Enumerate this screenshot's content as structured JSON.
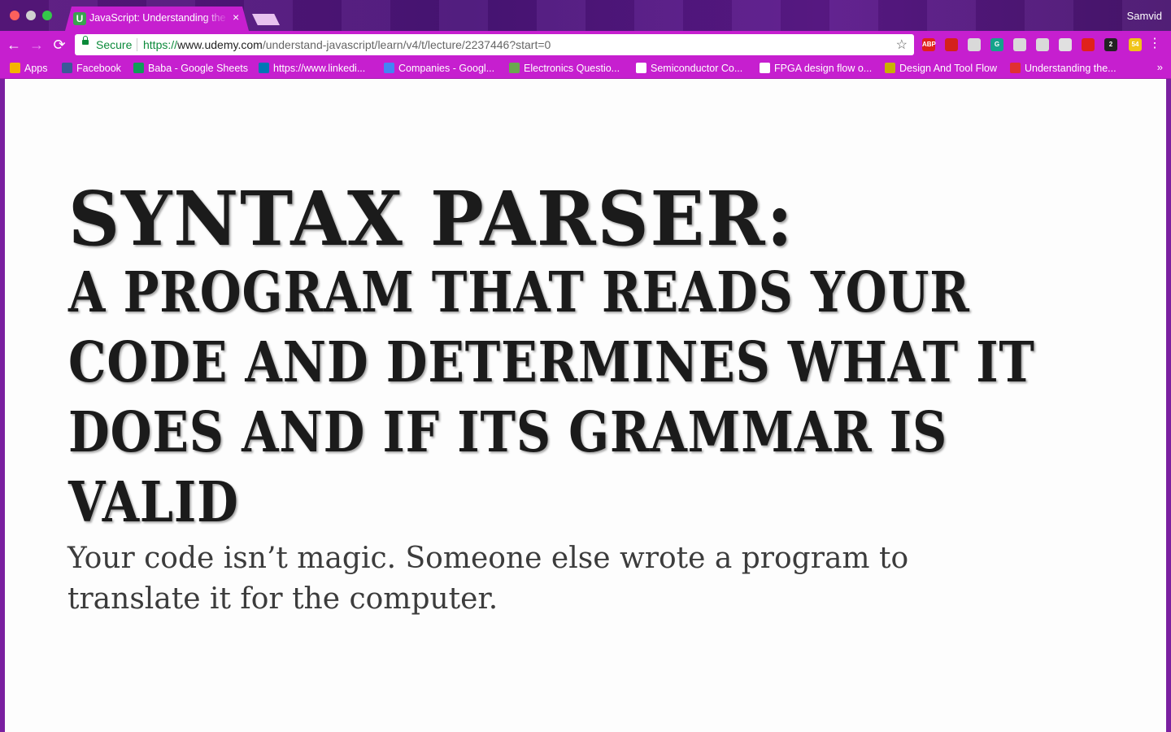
{
  "browser": {
    "tab": {
      "title": "JavaScript: Understanding the Weird Parts",
      "favicon_letter": "U",
      "close_label": "×"
    },
    "profile_name": "Samvid",
    "nav": {
      "back": "←",
      "forward": "→",
      "reload": "⟳"
    },
    "omnibox": {
      "secure_label": "Secure",
      "url_proto": "https://",
      "url_host": "www.udemy.com",
      "url_path": "/understand-javascript/learn/v4/t/lecture/2237446?start=0",
      "star": "☆"
    },
    "extensions": [
      {
        "name": "adblock-plus-icon",
        "label": "ABP",
        "color": "#e0221b"
      },
      {
        "name": "ublock-icon",
        "label": "",
        "color": "#d4211b"
      },
      {
        "name": "notes-ext-icon",
        "label": "",
        "color": "#d9d9d9"
      },
      {
        "name": "grammarly-icon",
        "label": "G",
        "color": "#15a38b"
      },
      {
        "name": "drive-icon",
        "label": "",
        "color": "#d9d9d9"
      },
      {
        "name": "mail-ext-icon",
        "label": "",
        "color": "#d9d9d9"
      },
      {
        "name": "chrome-cast-icon",
        "label": "",
        "color": "#e0e0e0"
      },
      {
        "name": "video-ext-icon",
        "label": "",
        "color": "#e0221b"
      },
      {
        "name": "amazon-ext-icon",
        "label": "2",
        "color": "#222222"
      },
      {
        "name": "calendar-ext-icon",
        "label": "54",
        "color": "#f0c419"
      }
    ],
    "menu": "⋮"
  },
  "bookmarks": {
    "items": [
      {
        "label": "Apps",
        "icon": "apps-grid-icon",
        "color": "#f4b400"
      },
      {
        "label": "Facebook",
        "icon": "facebook-icon",
        "color": "#3b5998"
      },
      {
        "label": "Baba - Google Sheets",
        "icon": "sheets-icon",
        "color": "#0f9d58"
      },
      {
        "label": "https://www.linkedi...",
        "icon": "linkedin-icon",
        "color": "#0077b5"
      },
      {
        "label": "Companies - Googl...",
        "icon": "docs-icon",
        "color": "#4285f4"
      },
      {
        "label": "Electronics Questio...",
        "icon": "leaf-icon",
        "color": "#6aa84f"
      },
      {
        "label": "Semiconductor Co...",
        "icon": "page-icon",
        "color": "#ffffff"
      },
      {
        "label": "FPGA design flow o...",
        "icon": "fpga-icon",
        "color": "#ffffff"
      },
      {
        "label": "Design And Tool Flow",
        "icon": "design-icon",
        "color": "#c9b100"
      },
      {
        "label": "Understanding the...",
        "icon": "slides-icon",
        "color": "#e03030"
      }
    ],
    "more": "»"
  },
  "slide": {
    "heading": "Syntax Parser:",
    "subheading": "A program that reads your code and determines what it does and if its grammar is valid",
    "body": "Your code isn’t magic. Someone else wrote a program to translate it for the computer."
  }
}
